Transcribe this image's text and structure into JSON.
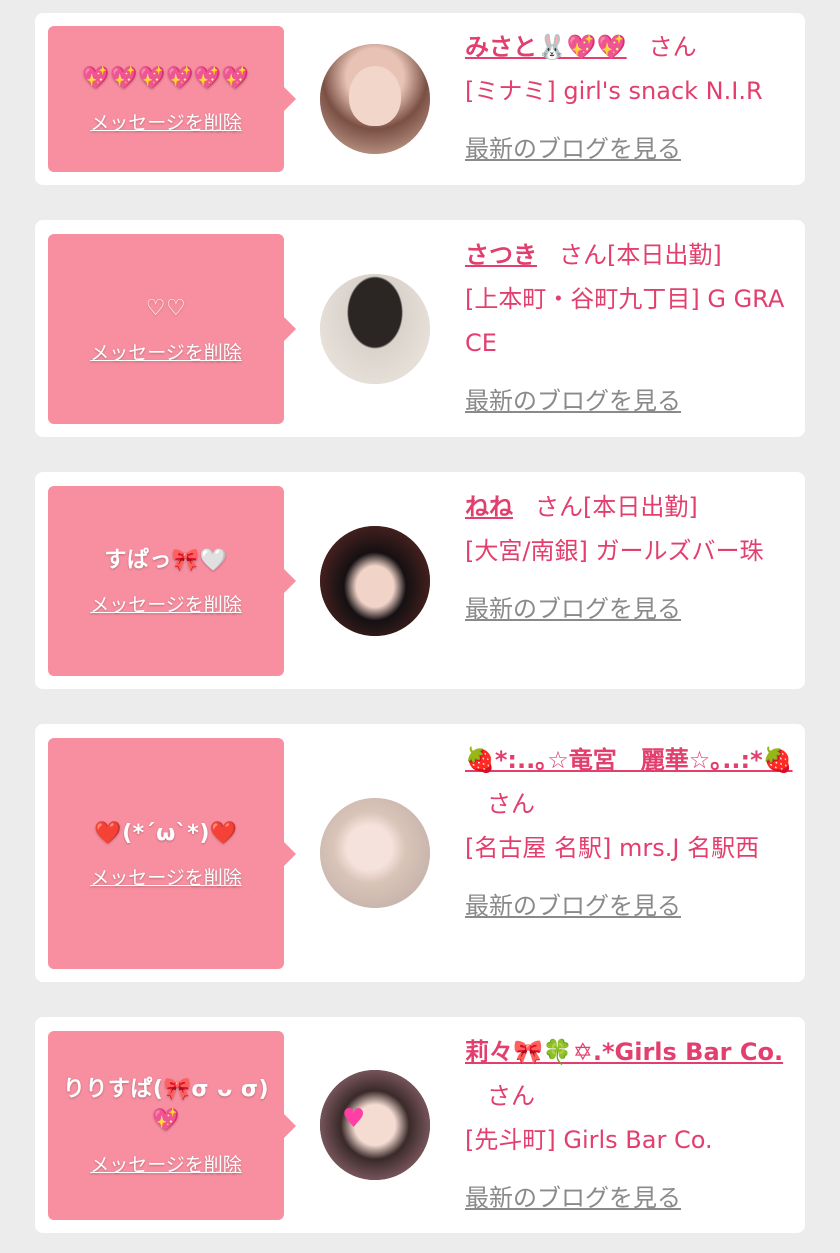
{
  "colors": {
    "accent": "#e23f6e",
    "bubble": "#f78fa0",
    "page_bg": "#ececec",
    "link_gray": "#8a8a8a"
  },
  "delete_label": "メッセージを削除",
  "blog_label": "最新のブログを見る",
  "honorific": "さん",
  "items": [
    {
      "message": "💖💖💖💖💖💖",
      "name": "みさと🐰💖💖",
      "status": "",
      "shop": "[ミナミ] girl's snack N.I.R",
      "avatar_icon": "girl-portrait-glitter"
    },
    {
      "message": "♡♡",
      "name": "さつき",
      "status": "[本日出勤]",
      "shop": "[上本町・谷町九丁目] G GRACE",
      "avatar_icon": "girl-braid-back"
    },
    {
      "message": "すぱっ🎀🤍",
      "name": "ねね",
      "status": "[本日出勤]",
      "shop": "[大宮/南銀] ガールズバー珠",
      "avatar_icon": "girl-black-hair"
    },
    {
      "message": "❤️(*´ω`*)❤️",
      "name": "🍓*:..｡☆竜宮　麗華☆｡..:*🍓",
      "status": "",
      "shop": "[名古屋 名駅] mrs.J 名駅西",
      "avatar_icon": "girl-blonde-peace"
    },
    {
      "message": "りりすぱ(🎀σ ᴗ σ)💖",
      "name": "莉々🎀🍀✡.*Girls Bar Co.",
      "status": "",
      "shop": "[先斗町] Girls Bar Co.",
      "avatar_icon": "girl-heart-filter"
    }
  ]
}
